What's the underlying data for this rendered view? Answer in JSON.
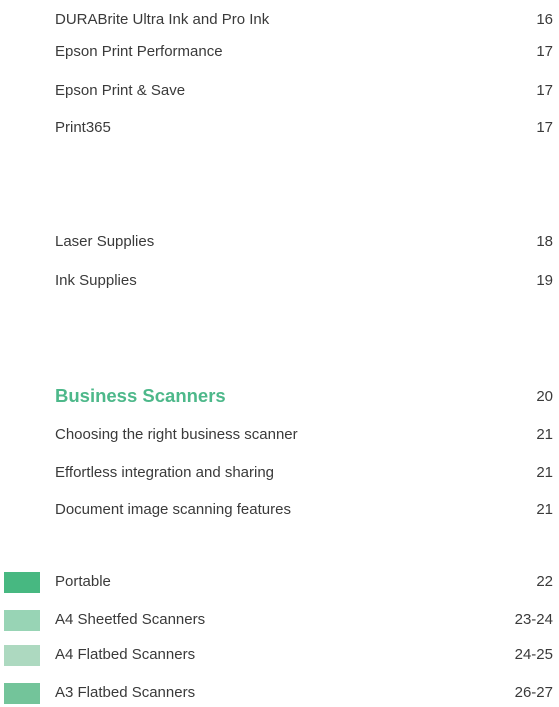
{
  "group1": [
    {
      "label": "DURABrite Ultra Ink and Pro Ink",
      "page": "16"
    },
    {
      "label": "Epson Print Performance",
      "page": "17"
    },
    {
      "label": "Epson Print & Save",
      "page": "17"
    },
    {
      "label": "Print365",
      "page": "17"
    }
  ],
  "group2": [
    {
      "label": "Laser Supplies",
      "page": "18"
    },
    {
      "label": "Ink Supplies",
      "page": "19"
    }
  ],
  "section": {
    "title": "Business Scanners",
    "page": "20",
    "color": "#4db88a"
  },
  "group3": [
    {
      "label": "Choosing the right business scanner",
      "page": "21"
    },
    {
      "label": "Effortless integration and sharing",
      "page": "21"
    },
    {
      "label": "Document image scanning features",
      "page": "21"
    }
  ],
  "group4": [
    {
      "label": "Portable",
      "page": "22",
      "swatch_color": "#47b881"
    },
    {
      "label": "A4 Sheetfed Scanners",
      "page": "23-24",
      "swatch_color": "#98d4b5"
    },
    {
      "label": "A4 Flatbed Scanners",
      "page": "24-25",
      "swatch_color": "#add9c0"
    },
    {
      "label": "A3 Flatbed Scanners",
      "page": "26-27",
      "swatch_color": "#73c49a"
    }
  ]
}
